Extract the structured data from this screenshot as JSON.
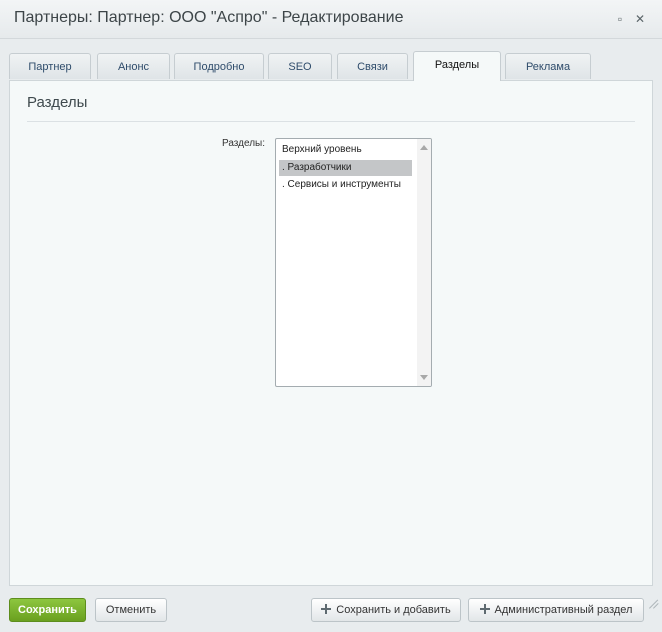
{
  "window": {
    "title": "Партнеры: Партнер: ООО \"Аспро\" - Редактирование"
  },
  "tabs": [
    {
      "label": "Партнер"
    },
    {
      "label": "Анонс"
    },
    {
      "label": "Подробно"
    },
    {
      "label": "SEO"
    },
    {
      "label": "Связи"
    },
    {
      "label": "Разделы",
      "active": true
    },
    {
      "label": "Реклама"
    }
  ],
  "panel": {
    "heading": "Разделы",
    "field_label": "Разделы:",
    "options": [
      "Верхний уровень",
      " . Разработчики",
      " . Сервисы и инструменты"
    ],
    "selected_option": " . Разработчики"
  },
  "footer": {
    "save_label": "Сохранить",
    "cancel_label": "Отменить",
    "save_add_label": "Сохранить и добавить",
    "admin_section_label": "Административный раздел"
  },
  "colors": {
    "primary_button": "#7ab52b",
    "selected_option": "#c4c6c8"
  }
}
